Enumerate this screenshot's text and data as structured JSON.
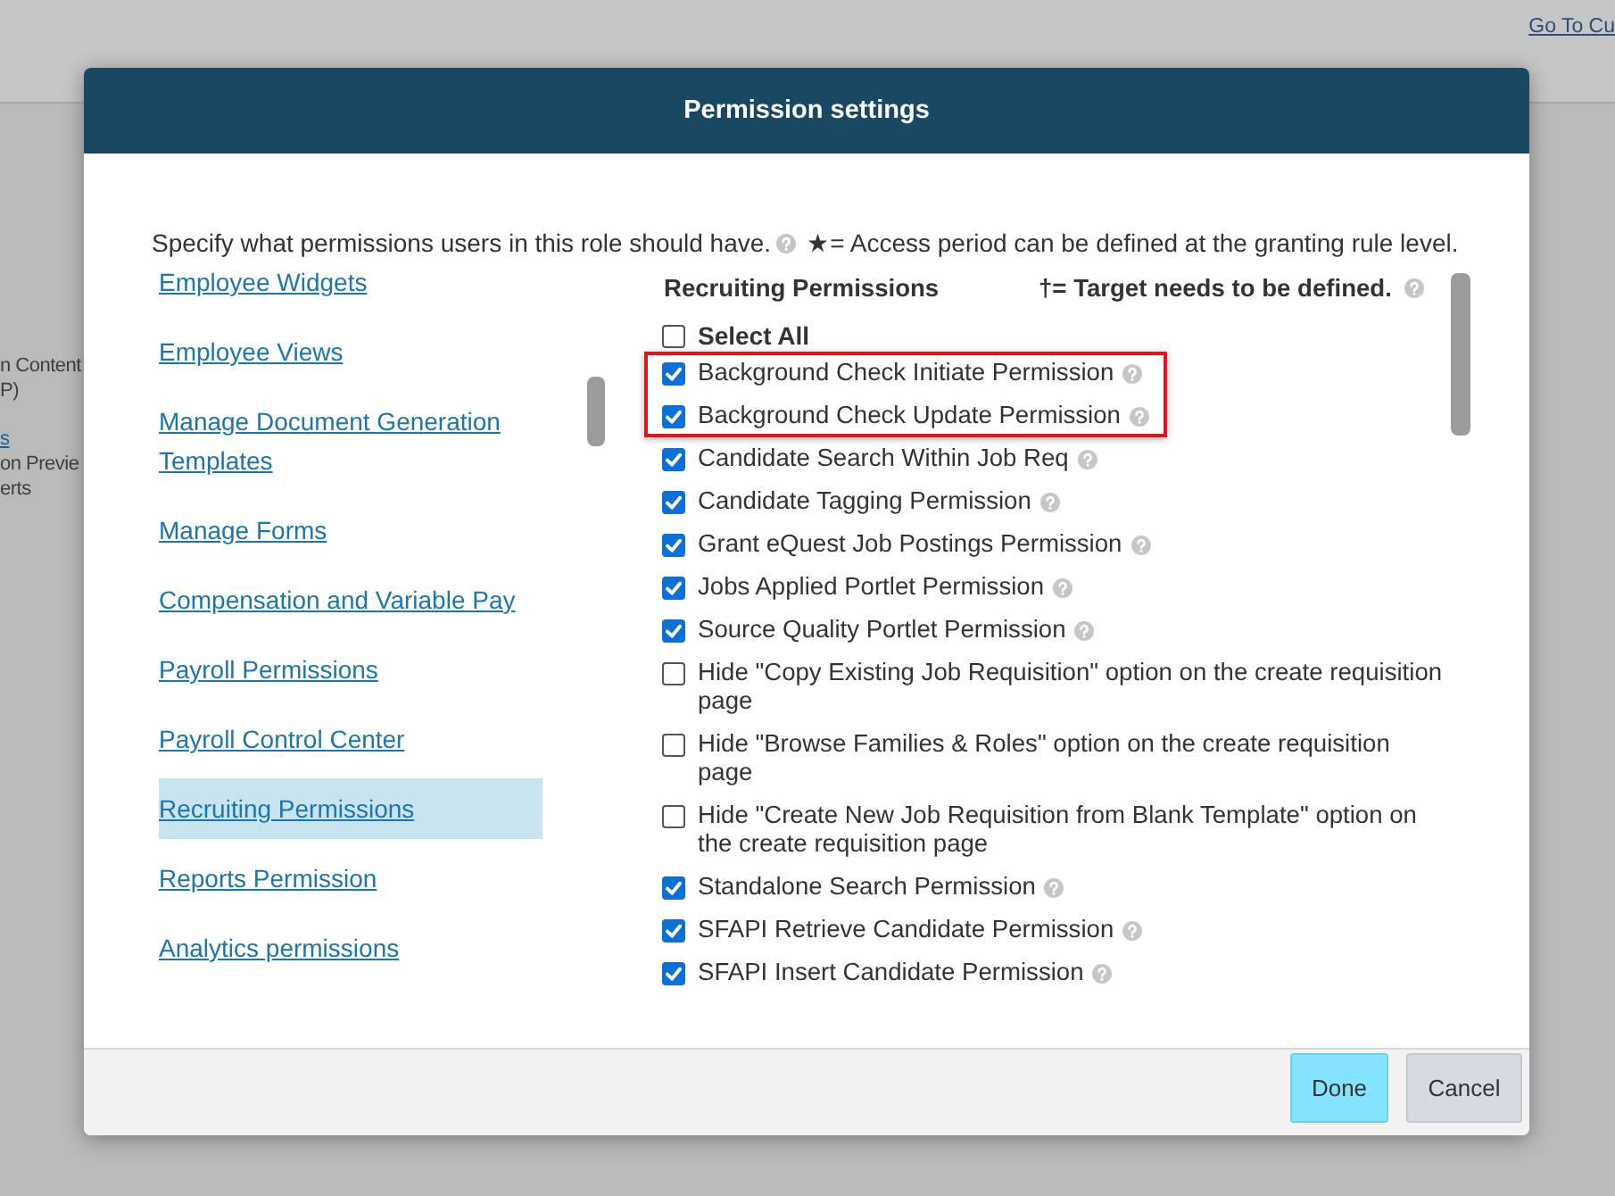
{
  "background_page": {
    "link": "Go To Cu",
    "fragments": [
      {
        "text": "n Content",
        "kind": "text"
      },
      {
        "text": "P)",
        "kind": "text"
      },
      {
        "text": "s",
        "kind": "link"
      },
      {
        "text": "on Previe",
        "kind": "text"
      },
      {
        "text": "erts",
        "kind": "text"
      }
    ]
  },
  "dialog": {
    "title": "Permission settings",
    "intro": "Specify what permissions users in this role should have.",
    "legend": "★= Access period can be defined at the granting rule level.",
    "nav_items": [
      {
        "label": "Employee Widgets",
        "selected": false
      },
      {
        "label": "Employee Views",
        "selected": false
      },
      {
        "label": "Manage Document Generation Templates",
        "selected": false
      },
      {
        "label": "Manage Forms",
        "selected": false
      },
      {
        "label": "Compensation and Variable Pay",
        "selected": false
      },
      {
        "label": "Payroll Permissions",
        "selected": false
      },
      {
        "label": "Payroll Control Center",
        "selected": false
      },
      {
        "label": "Recruiting Permissions",
        "selected": true
      },
      {
        "label": "Reports Permission",
        "selected": false
      },
      {
        "label": "Analytics permissions",
        "selected": false
      }
    ],
    "panel": {
      "title": "Recruiting Permissions",
      "legend": "†= Target needs to be defined.",
      "select_all": {
        "label": "Select All",
        "checked": false
      },
      "permissions": [
        {
          "label": "Background Check Initiate Permission",
          "checked": true,
          "help": true,
          "highlighted": true
        },
        {
          "label": "Background Check Update Permission",
          "checked": true,
          "help": true,
          "highlighted": true
        },
        {
          "label": "Candidate Search Within Job Req",
          "checked": true,
          "help": true,
          "highlighted": false
        },
        {
          "label": "Candidate Tagging Permission",
          "checked": true,
          "help": true,
          "highlighted": false
        },
        {
          "label": "Grant eQuest Job Postings Permission",
          "checked": true,
          "help": true,
          "highlighted": false
        },
        {
          "label": "Jobs Applied Portlet Permission",
          "checked": true,
          "help": true,
          "highlighted": false
        },
        {
          "label": "Source Quality Portlet Permission",
          "checked": true,
          "help": true,
          "highlighted": false
        },
        {
          "label": "Hide \"Copy Existing Job Requisition\" option on the create requisition page",
          "checked": false,
          "help": false,
          "highlighted": false
        },
        {
          "label": "Hide \"Browse Families & Roles\" option on the create requisition page",
          "checked": false,
          "help": false,
          "highlighted": false
        },
        {
          "label": "Hide \"Create New Job Requisition from Blank Template\" option on the create requisition page",
          "checked": false,
          "help": false,
          "highlighted": false
        },
        {
          "label": "Standalone Search Permission",
          "checked": true,
          "help": true,
          "highlighted": false
        },
        {
          "label": "SFAPI Retrieve Candidate Permission",
          "checked": true,
          "help": true,
          "highlighted": false
        },
        {
          "label": "SFAPI Insert Candidate Permission",
          "checked": true,
          "help": true,
          "highlighted": false
        }
      ]
    },
    "buttons": [
      {
        "label": "Done",
        "kind": "primary"
      },
      {
        "label": "Cancel",
        "kind": "secondary"
      }
    ]
  }
}
